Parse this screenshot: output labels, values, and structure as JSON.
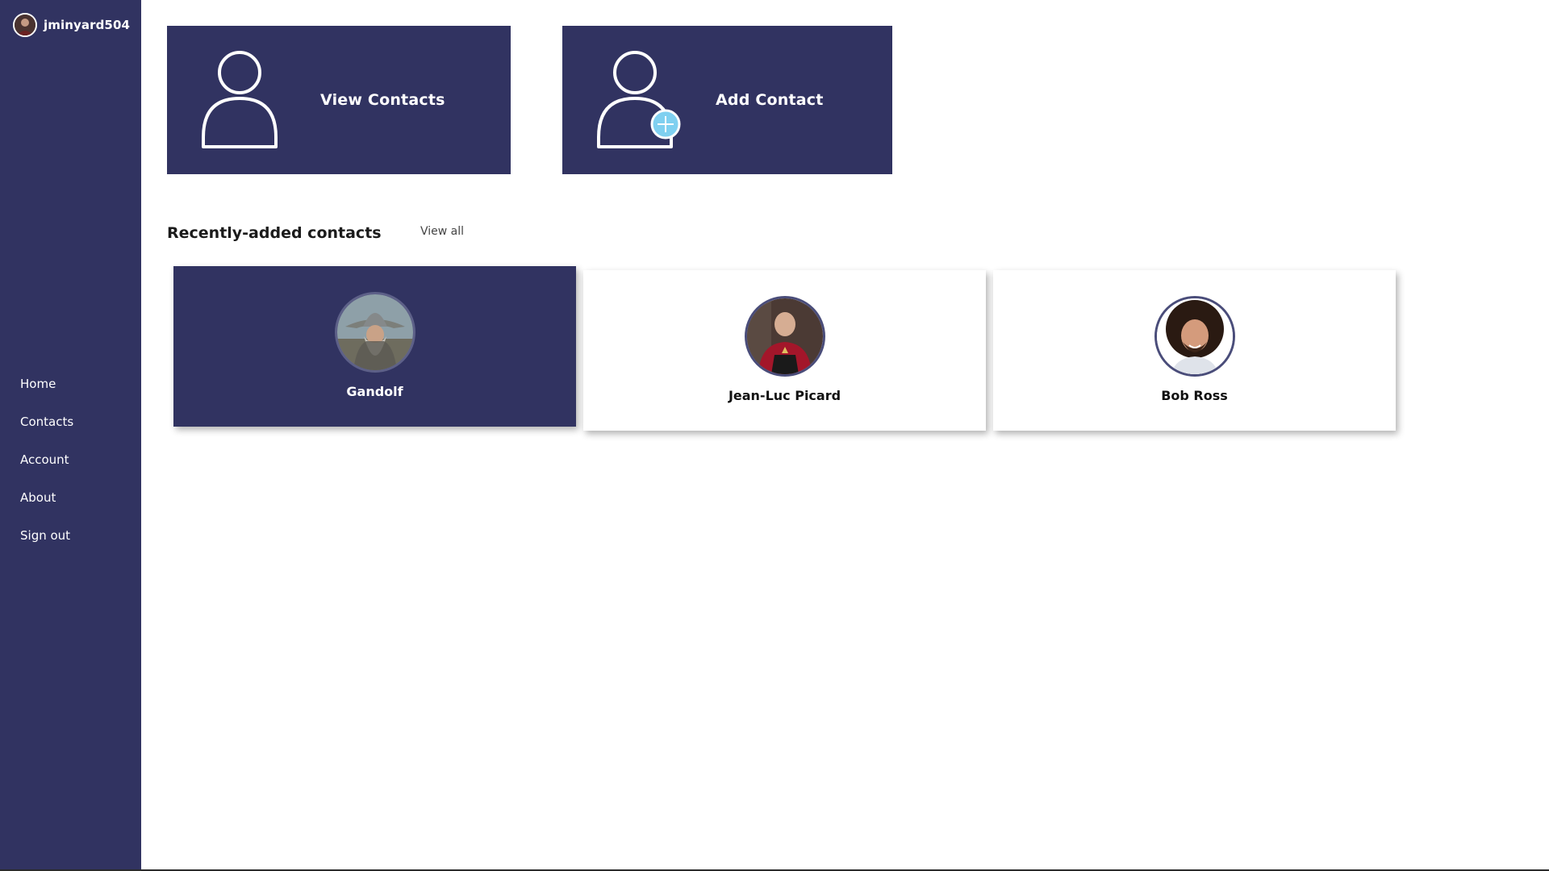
{
  "user": {
    "username": "jminyard504"
  },
  "nav": {
    "items": [
      {
        "label": "Home"
      },
      {
        "label": "Contacts"
      },
      {
        "label": "Account"
      },
      {
        "label": "About"
      },
      {
        "label": "Sign out"
      }
    ]
  },
  "actions": {
    "view_contacts": "View Contacts",
    "add_contact": "Add Contact"
  },
  "recent": {
    "title": "Recently-added contacts",
    "view_all": "View all",
    "contacts": [
      {
        "name": "Gandolf",
        "selected": true
      },
      {
        "name": "Jean-Luc Picard",
        "selected": false
      },
      {
        "name": "Bob Ross",
        "selected": false
      }
    ]
  },
  "colors": {
    "primary": "#313361",
    "accent_plus": "#7fd0f0",
    "text_dark": "#1b1b1b"
  }
}
